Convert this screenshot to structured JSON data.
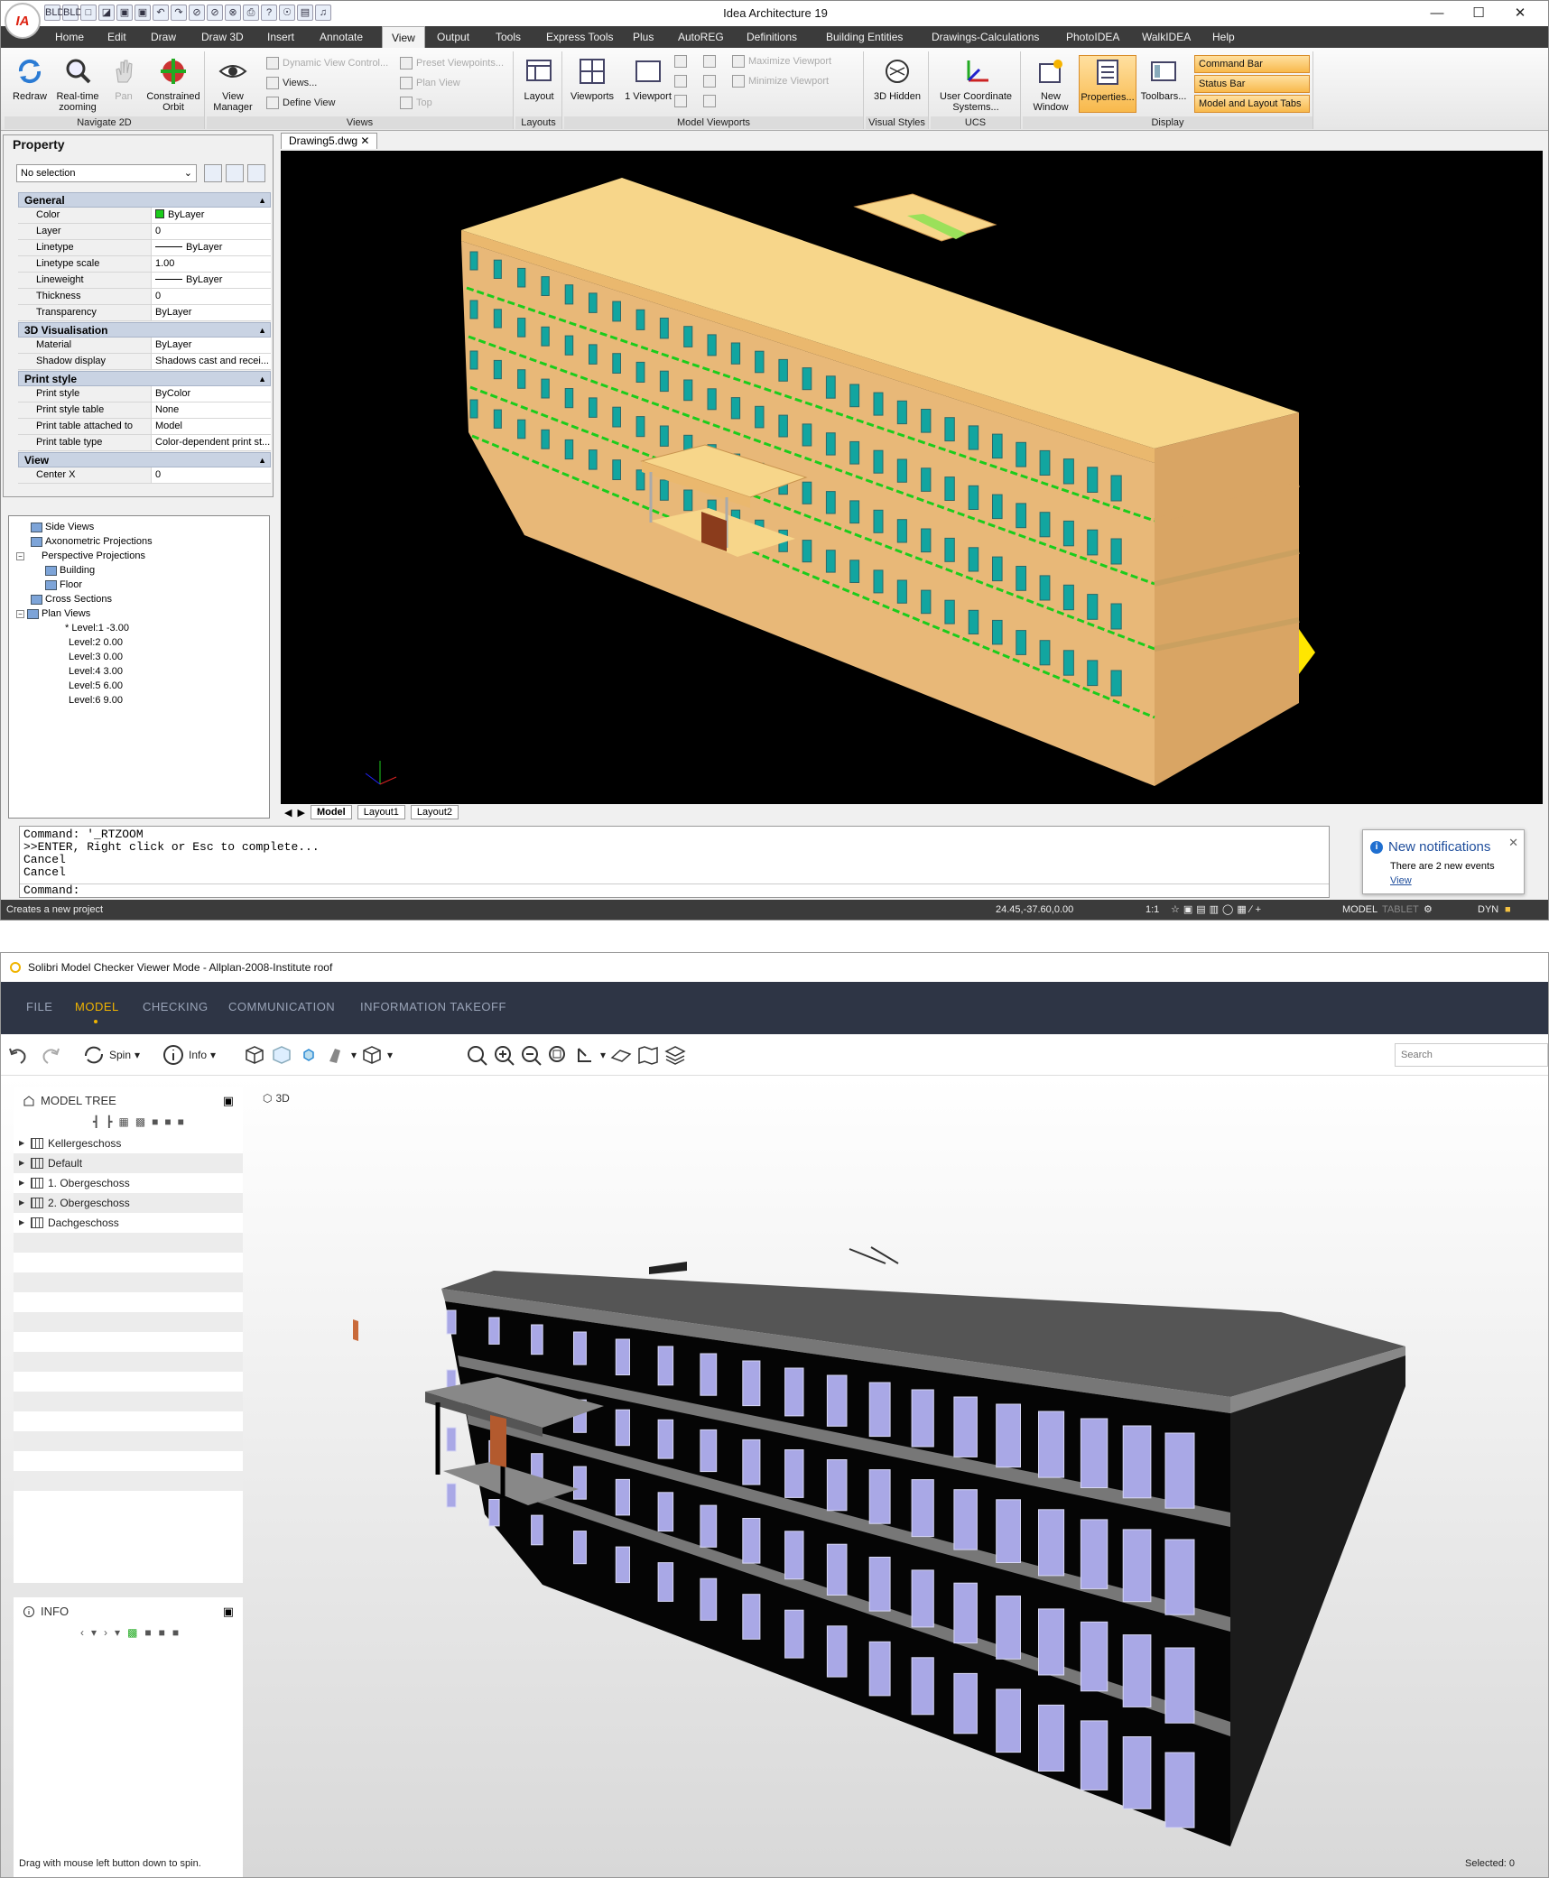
{
  "app1": {
    "title": "Idea Architecture 19",
    "logo_text": "IA",
    "quick_access": [
      "BLD",
      "BLD",
      "new",
      "open",
      "save",
      "print",
      "undo",
      "redo",
      "help",
      "layers"
    ],
    "window_controls": {
      "minimize": "—",
      "maximize": "☐",
      "close": "✕"
    },
    "menu": [
      "Home",
      "Edit",
      "Draw",
      "Draw 3D",
      "Insert",
      "Annotate",
      "View",
      "Output",
      "Tools",
      "Express Tools",
      "Plus",
      "AutoREG",
      "Definitions",
      "Building Entities",
      "Drawings-Calculations",
      "PhotoIDEA",
      "WalkIDEA",
      "Help"
    ],
    "active_menu": "View",
    "ribbon": {
      "navigate2d": {
        "label": "Navigate 2D",
        "redraw": "Redraw",
        "realtime": "Real-time zooming",
        "pan": "Pan",
        "orbit": "Constrained Orbit"
      },
      "views": {
        "label": "Views",
        "view_manager": "View Manager",
        "dynamic": "Dynamic View Control...",
        "views_item": "Views...",
        "define": "Define View",
        "preset": "Preset Viewpoints...",
        "plan": "Plan View",
        "top": "Top"
      },
      "layouts": {
        "label": "Layouts",
        "layout": "Layout"
      },
      "model_viewports": {
        "label": "Model Viewports",
        "viewports": "Viewports",
        "one_viewport": "1 Viewport",
        "maximize": "Maximize Viewport",
        "minimize": "Minimize Viewport"
      },
      "visual_styles": {
        "label": "Visual Styles",
        "hidden": "3D Hidden"
      },
      "ucs": {
        "label": "UCS",
        "ucs_btn": "User Coordinate Systems..."
      },
      "display": {
        "label": "Display",
        "new_window": "New Window",
        "properties": "Properties...",
        "toolbars": "Toolbars...",
        "command_bar": "Command Bar",
        "status_bar": "Status Bar",
        "model_layout_tabs": "Model and Layout Tabs"
      }
    },
    "property": {
      "title": "Property",
      "selection": "No selection",
      "categories": [
        {
          "name": "General",
          "rows": [
            {
              "k": "Color",
              "v": "ByLayer"
            },
            {
              "k": "Layer",
              "v": "0"
            },
            {
              "k": "Linetype",
              "v": "ByLayer"
            },
            {
              "k": "Linetype scale",
              "v": "1.00"
            },
            {
              "k": "Lineweight",
              "v": "ByLayer"
            },
            {
              "k": "Thickness",
              "v": "0"
            },
            {
              "k": "Transparency",
              "v": "ByLayer"
            }
          ]
        },
        {
          "name": "3D Visualisation",
          "rows": [
            {
              "k": "Material",
              "v": "ByLayer"
            },
            {
              "k": "Shadow display",
              "v": "Shadows cast and recei..."
            }
          ]
        },
        {
          "name": "Print style",
          "rows": [
            {
              "k": "Print style",
              "v": "ByColor"
            },
            {
              "k": "Print style table",
              "v": "None"
            },
            {
              "k": "Print table attached to",
              "v": "Model"
            },
            {
              "k": "Print table type",
              "v": "Color-dependent print st..."
            }
          ]
        },
        {
          "name": "View",
          "rows": [
            {
              "k": "Center X",
              "v": "0"
            }
          ]
        }
      ]
    },
    "tree": {
      "side_views": "Side Views",
      "axonometric": "Axonometric Projections",
      "perspective": "Perspective Projections",
      "building": "Building",
      "floor": "Floor",
      "cross_sections": "Cross Sections",
      "plan_views": "Plan Views",
      "levels": [
        "* Level:1  -3.00",
        "Level:2  0.00",
        "Level:3  0.00",
        "Level:4  3.00",
        "Level:5  6.00",
        "Level:6  9.00"
      ]
    },
    "doc_tab": "Drawing5.dwg",
    "layout_tabs": [
      "Model",
      "Layout1",
      "Layout2"
    ],
    "command_lines": [
      "Command: '_RTZOOM",
      ">>ENTER, Right click or Esc to complete...",
      "Cancel",
      "Cancel"
    ],
    "command_prompt": "Command:",
    "notification": {
      "title": "New notifications",
      "body": "There are 2 new events",
      "link": "View"
    },
    "status": {
      "left": "Creates a new project",
      "coords": "24.45,-37.60,0.00",
      "scale": "1:1",
      "model": "MODEL",
      "tablet": "TABLET",
      "dyn": "DYN"
    },
    "colors": {
      "building_wall": "#e8b878",
      "building_roof": "#f7d68a",
      "window": "#12a5a0",
      "ucs_green": "#1bcc1b"
    }
  },
  "app2": {
    "title": "Solibri Model Checker Viewer Mode - Allplan-2008-Institute roof",
    "menu": [
      "FILE",
      "MODEL",
      "CHECKING",
      "COMMUNICATION",
      "INFORMATION TAKEOFF"
    ],
    "active_menu": "MODEL",
    "toolbar": {
      "spin": "Spin",
      "info": "Info"
    },
    "search_placeholder": "Search",
    "model_tree": {
      "title": "MODEL TREE",
      "items": [
        "Kellergeschoss",
        "Default",
        "1. Obergeschoss",
        "2. Obergeschoss",
        "Dachgeschoss"
      ]
    },
    "info": {
      "title": "INFO"
    },
    "view_label": "3D",
    "status_left": "Drag with mouse left button down to spin.",
    "status_right": "Selected: 0",
    "colors": {
      "accent": "#f0b400",
      "menu_bg": "#2e3545",
      "building_wall": "#050505",
      "window": "#a9a8e6"
    }
  }
}
